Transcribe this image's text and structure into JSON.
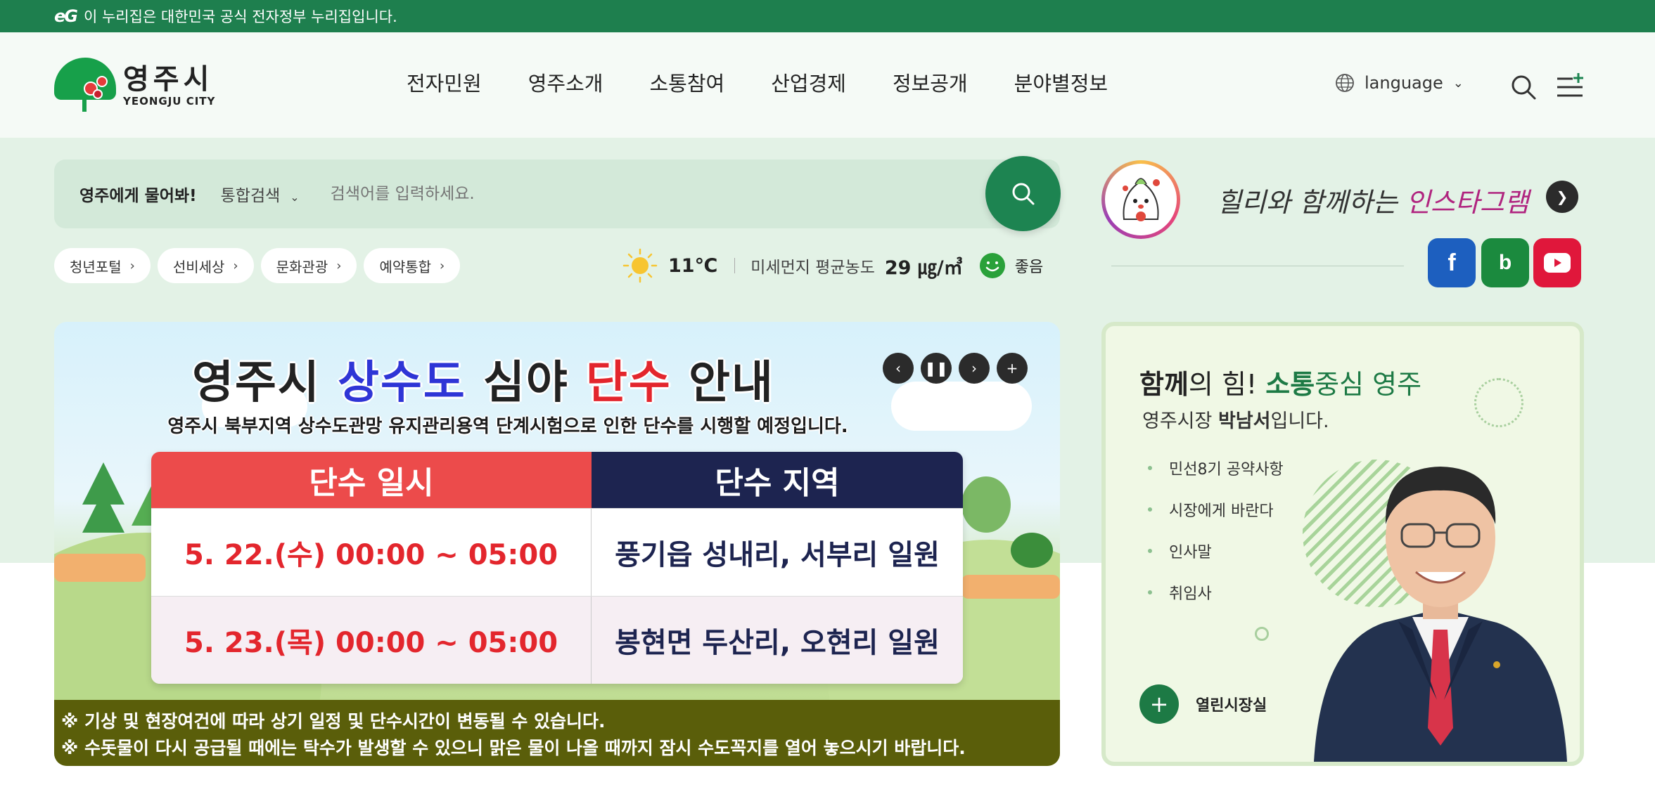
{
  "gov_bar": {
    "mark": "eG",
    "text": "이 누리집은 대한민국 공식 전자정부 누리집입니다."
  },
  "header": {
    "logo_ko": "영주시",
    "logo_en": "YEONGJU CITY",
    "nav": [
      "전자민원",
      "영주소개",
      "소통참여",
      "산업경제",
      "정보공개",
      "분야별정보"
    ],
    "language_label": "language"
  },
  "search": {
    "ask_label": "영주에게 물어봐!",
    "scope_label": "통합검색",
    "placeholder": "검색어를 입력하세요."
  },
  "quick_links": [
    "청년포털",
    "선비세상",
    "문화관광",
    "예약통합"
  ],
  "weather": {
    "temperature": "11℃",
    "dust_label": "미세먼지 평균농도",
    "dust_value": "29 ㎍/㎥",
    "dust_status": "좋음"
  },
  "instagram": {
    "slogan_prefix": "힐리와 함께하는 ",
    "slogan_highlight": "인스타그램"
  },
  "social": {
    "facebook": "f",
    "blog": "b"
  },
  "banner": {
    "title_part1": "영주시 ",
    "title_blue": "상수도",
    "title_part2": " 심야 ",
    "title_red": "단수",
    "title_part3": " 안내",
    "subtitle": "영주시 북부지역 상수도관망 유지관리용역 단계시험으로 인한 단수를 시행할 예정입니다.",
    "col1_header": "단수 일시",
    "col2_header": "단수 지역",
    "rows": [
      {
        "date": "5. 22.(수) 00:00 ~ 05:00",
        "area": "풍기읍 성내리, 서부리 일원"
      },
      {
        "date": "5. 23.(목) 00:00 ~ 05:00",
        "area": "봉현면 두산리, 오현리 일원"
      }
    ],
    "note1": "※ 기상 및 현장여건에 따라 상기 일정 및 단수시간이 변동될 수 있습니다.",
    "note2": "※ 수돗물이 다시 공급될 때에는 탁수가 발생할 수 있으니 맑은 물이 나올 때까지 잠시 수도꼭지를 열어 놓으시기 바랍니다."
  },
  "mayor": {
    "title_a": "함께",
    "title_b": "의 힘! ",
    "title_c": "소통",
    "title_d": "중심 영주",
    "intro_a": "영주시장 ",
    "intro_name": "박남서",
    "intro_b": "입니다.",
    "links": [
      "민선8기 공약사항",
      "시장에게 바란다",
      "인사말",
      "취임사"
    ],
    "more_label": "열린시장실"
  }
}
